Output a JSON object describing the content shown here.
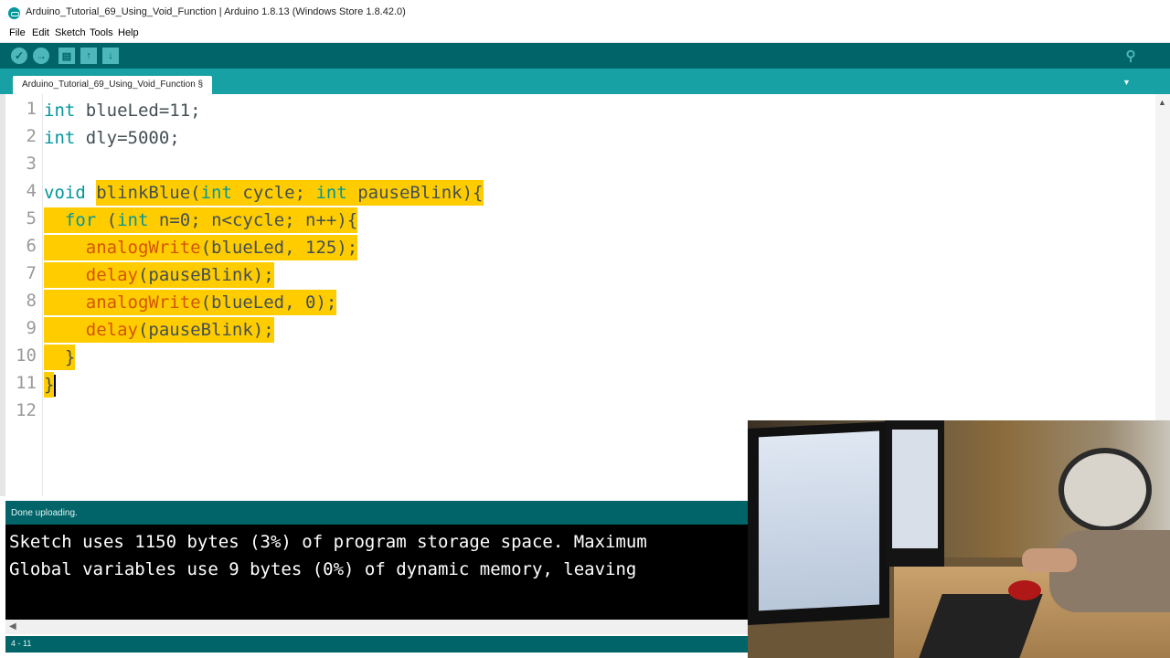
{
  "window": {
    "title": "Arduino_Tutorial_69_Using_Void_Function | Arduino 1.8.13 (Windows Store 1.8.42.0)"
  },
  "menu": [
    "File",
    "Edit",
    "Sketch",
    "Tools",
    "Help"
  ],
  "toolbar": {
    "verify_icon": "✓",
    "upload_icon": "→",
    "new_icon": "▤",
    "open_icon": "↑",
    "save_icon": "↓",
    "serial_monitor_icon": "⚲"
  },
  "tab": {
    "label": "Arduino_Tutorial_69_Using_Void_Function §"
  },
  "editor": {
    "line_numbers": [
      "1",
      "2",
      "3",
      "4",
      "5",
      "6",
      "7",
      "8",
      "9",
      "10",
      "11",
      "12"
    ],
    "lines": {
      "l1": {
        "kw": "int",
        "rest": " blueLed=11;"
      },
      "l2": {
        "kw": "int",
        "rest": " dly=5000;"
      },
      "l4": {
        "kw": "void",
        "sp": " ",
        "a": "blinkBlue(",
        "kw2": "int",
        "b": " cycle; ",
        "kw3": "int",
        "c": " pauseBlink){"
      },
      "l5": {
        "indent": "  ",
        "kw": "for",
        "a": " (",
        "kw2": "int",
        "b": " n=0; n<cycle; n++){"
      },
      "l6": {
        "indent": "    ",
        "fn": "analogWrite",
        "rest": "(blueLed, 125);"
      },
      "l7": {
        "indent": "    ",
        "fn": "delay",
        "rest": "(pauseBlink);"
      },
      "l8": {
        "indent": "    ",
        "fn": "analogWrite",
        "rest": "(blueLed, 0);"
      },
      "l9": {
        "indent": "    ",
        "fn": "delay",
        "rest": "(pauseBlink);"
      },
      "l10": {
        "indent": "  ",
        "rest": "}"
      },
      "l11": {
        "rest": "}"
      }
    }
  },
  "status": {
    "message": "Done uploading."
  },
  "console": {
    "lines": [
      "Sketch uses 1150 bytes (3%) of program storage space. Maximum",
      "Global variables use 9 bytes (0%) of dynamic memory, leaving"
    ]
  },
  "cursor_position": "4 - 11",
  "colors": {
    "toolbar": "#006468",
    "tabbar": "#17a1a5",
    "keyword": "#00979c",
    "function": "#d35400",
    "selection": "#ffcc00"
  }
}
